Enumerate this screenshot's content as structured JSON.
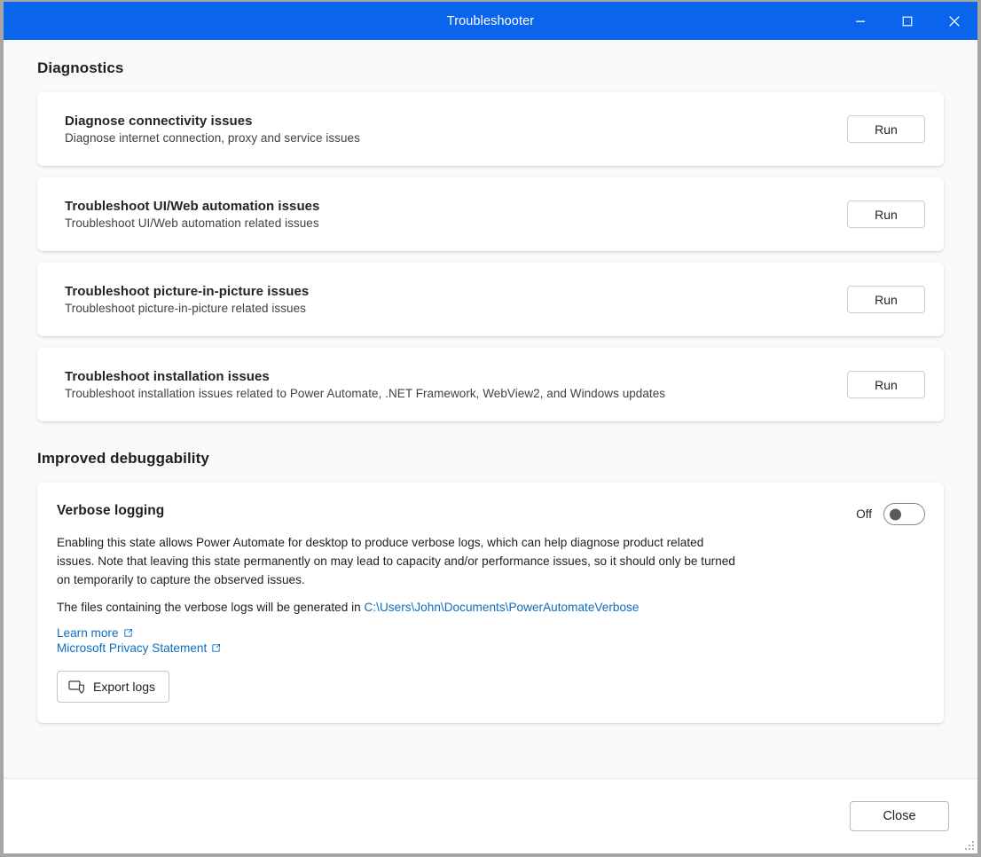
{
  "window": {
    "title": "Troubleshooter",
    "controls": {
      "minimize": "minimize",
      "maximize": "maximize",
      "close": "close"
    }
  },
  "sections": {
    "diagnostics": {
      "heading": "Diagnostics",
      "items": [
        {
          "title": "Diagnose connectivity issues",
          "subtitle": "Diagnose internet connection, proxy and service issues",
          "action": "Run"
        },
        {
          "title": "Troubleshoot UI/Web automation issues",
          "subtitle": "Troubleshoot UI/Web automation related issues",
          "action": "Run"
        },
        {
          "title": "Troubleshoot picture-in-picture issues",
          "subtitle": "Troubleshoot picture-in-picture related issues",
          "action": "Run"
        },
        {
          "title": "Troubleshoot installation issues",
          "subtitle": "Troubleshoot installation issues related to Power Automate, .NET Framework, WebView2, and Windows updates",
          "action": "Run"
        }
      ]
    },
    "debuggability": {
      "heading": "Improved debuggability",
      "verbose_logging": {
        "title": "Verbose logging",
        "toggle_state_label": "Off",
        "toggle_on": false,
        "description": "Enabling this state allows Power Automate for desktop to produce verbose logs, which can help diagnose product related issues. Note that leaving this state permanently on may lead to capacity and/or performance issues, so it should only be turned on temporarily to capture the observed issues.",
        "path_prefix": "The files containing the verbose logs will be generated in ",
        "path_value": "C:\\Users\\John\\Documents\\PowerAutomateVerbose",
        "links": [
          {
            "label": "Learn more",
            "icon": "external-link-icon"
          },
          {
            "label": "Microsoft Privacy Statement",
            "icon": "external-link-icon"
          }
        ],
        "export_button": {
          "label": "Export logs",
          "icon": "export-shield-icon"
        }
      }
    }
  },
  "footer": {
    "close_label": "Close"
  },
  "colors": {
    "titlebar": "#0a64ec",
    "content_bg": "#f9f9f8",
    "card_bg": "#ffffff",
    "link": "#0f6cbd",
    "text_primary": "#1f1f1f"
  }
}
